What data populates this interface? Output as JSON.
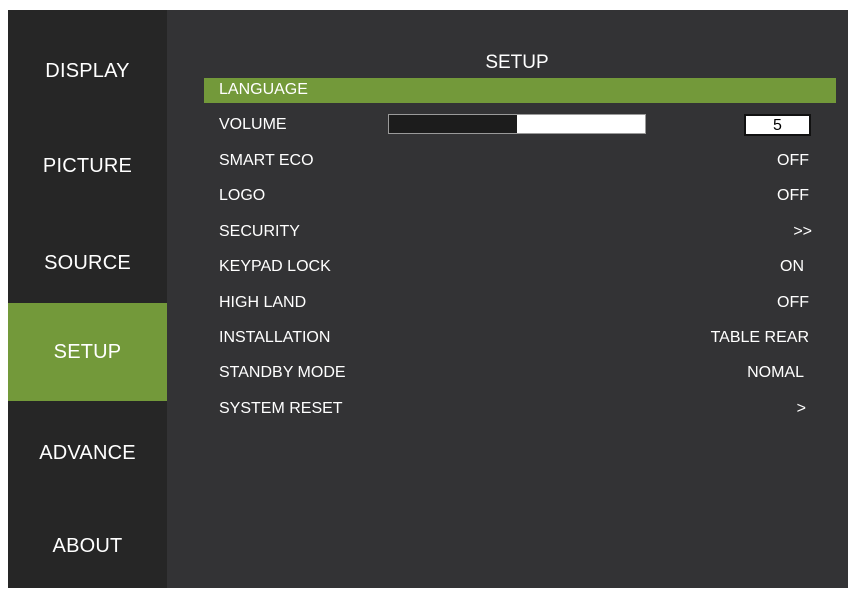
{
  "sidebar": {
    "items": [
      {
        "label": "DISPLAY"
      },
      {
        "label": "PICTURE"
      },
      {
        "label": "SOURCE"
      },
      {
        "label": "SETUP"
      },
      {
        "label": "ADVANCE"
      },
      {
        "label": "ABOUT"
      }
    ],
    "active": "SETUP"
  },
  "main": {
    "title": "SETUP",
    "rows": [
      {
        "label": "LANGUAGE",
        "value": ""
      },
      {
        "label": "VOLUME",
        "value": "5"
      },
      {
        "label": "SMART ECO",
        "value": "OFF"
      },
      {
        "label": "LOGO",
        "value": "OFF"
      },
      {
        "label": "SECURITY",
        "value": ">>"
      },
      {
        "label": "KEYPAD LOCK",
        "value": "ON"
      },
      {
        "label": "HIGH LAND",
        "value": "OFF"
      },
      {
        "label": "INSTALLATION",
        "value": "TABLE REAR"
      },
      {
        "label": "STANDBY MODE",
        "value": "NOMAL"
      },
      {
        "label": "SYSTEM RESET",
        "value": ">"
      }
    ],
    "selected_row": "LANGUAGE",
    "volume_bar_fill_fraction": 0.5
  },
  "colors": {
    "background": "#333335",
    "sidebar": "#262626",
    "accent": "#73993a",
    "text": "#ffffff"
  }
}
